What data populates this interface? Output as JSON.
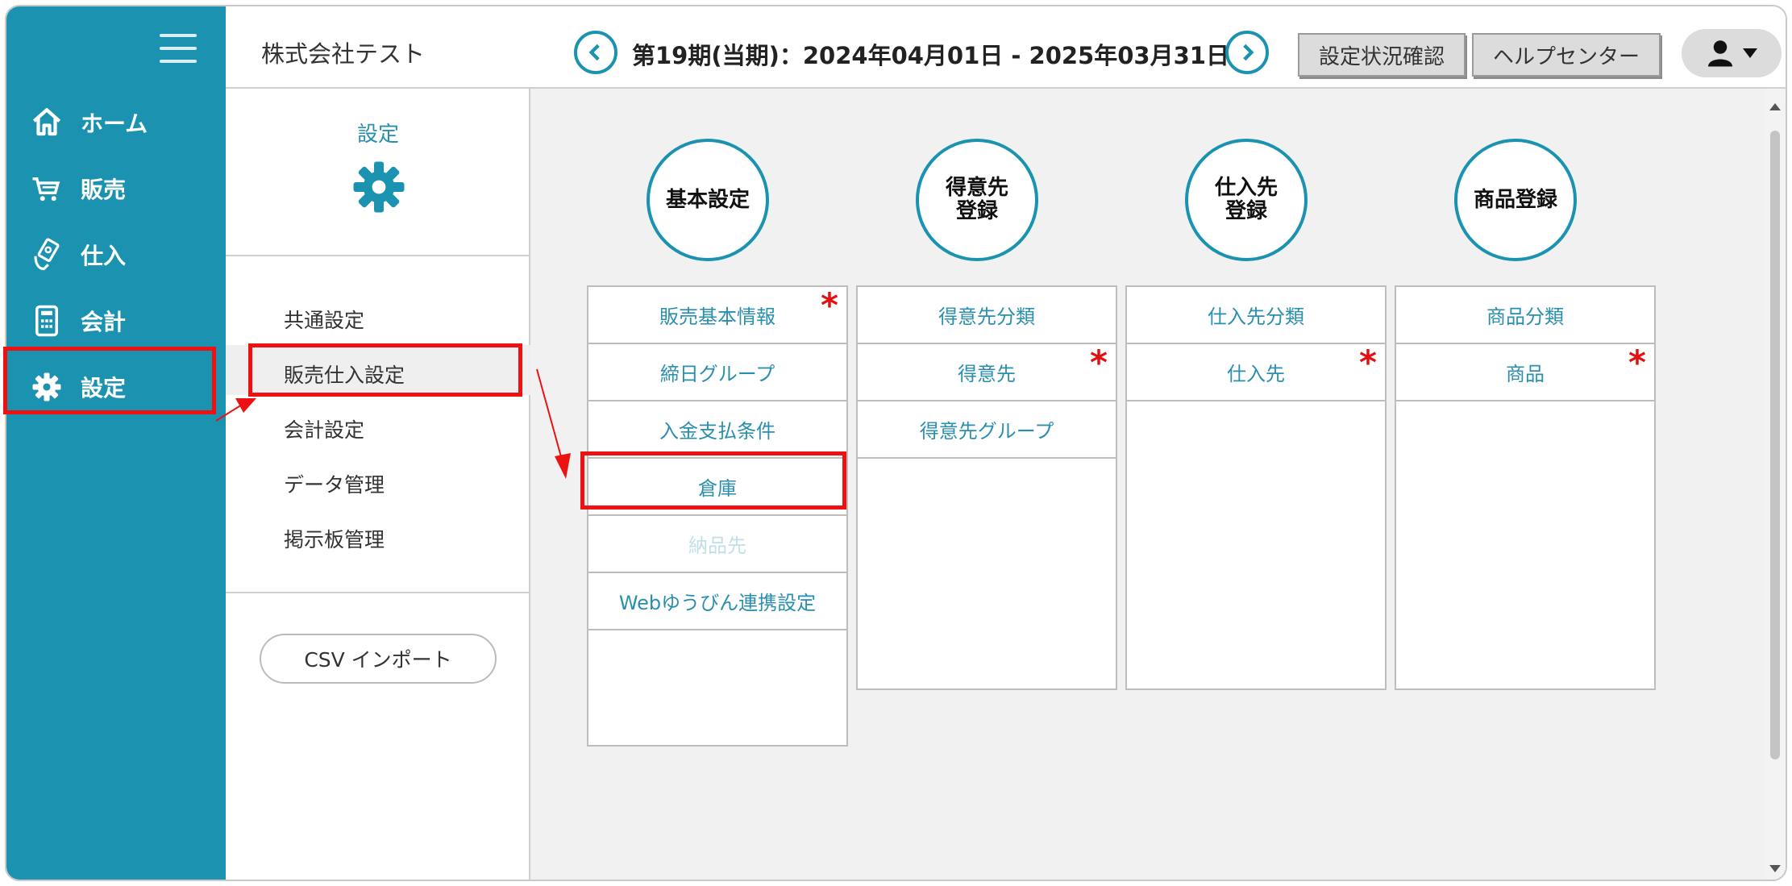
{
  "company": "株式会社テスト",
  "period": "第19期(当期)：2024年04月01日 - 2025年03月31日",
  "header_buttons": {
    "status": "設定状況確認",
    "help": "ヘルプセンター"
  },
  "nav": {
    "items": [
      {
        "label": "ホーム",
        "icon": "home-icon"
      },
      {
        "label": "販売",
        "icon": "cart-icon"
      },
      {
        "label": "仕入",
        "icon": "hand-money-icon"
      },
      {
        "label": "会計",
        "icon": "calculator-icon"
      },
      {
        "label": "設定",
        "icon": "gear-icon"
      }
    ]
  },
  "submenu": {
    "title": "設定",
    "items": [
      "共通設定",
      "販売仕入設定",
      "会計設定",
      "データ管理",
      "掲示板管理"
    ],
    "csv_button": "CSV インポート"
  },
  "sections": [
    {
      "title": "基本設定",
      "items": [
        {
          "label": "販売基本情報",
          "required": true
        },
        {
          "label": "締日グループ"
        },
        {
          "label": "入金支払条件"
        },
        {
          "label": "倉庫"
        },
        {
          "label": "納品先",
          "disabled": true
        },
        {
          "label": "Webゆうびん連携設定"
        }
      ]
    },
    {
      "title": "得意先\n登録",
      "items": [
        {
          "label": "得意先分類"
        },
        {
          "label": "得意先",
          "required": true
        },
        {
          "label": "得意先グループ"
        }
      ]
    },
    {
      "title": "仕入先\n登録",
      "items": [
        {
          "label": "仕入先分類"
        },
        {
          "label": "仕入先",
          "required": true
        }
      ]
    },
    {
      "title": "商品登録",
      "items": [
        {
          "label": "商品分類"
        },
        {
          "label": "商品",
          "required": true
        }
      ]
    }
  ],
  "colors": {
    "nav": "#1b93b0",
    "accent": "#2a8fae",
    "highlight": "#ee1111",
    "required": "#e21111"
  }
}
